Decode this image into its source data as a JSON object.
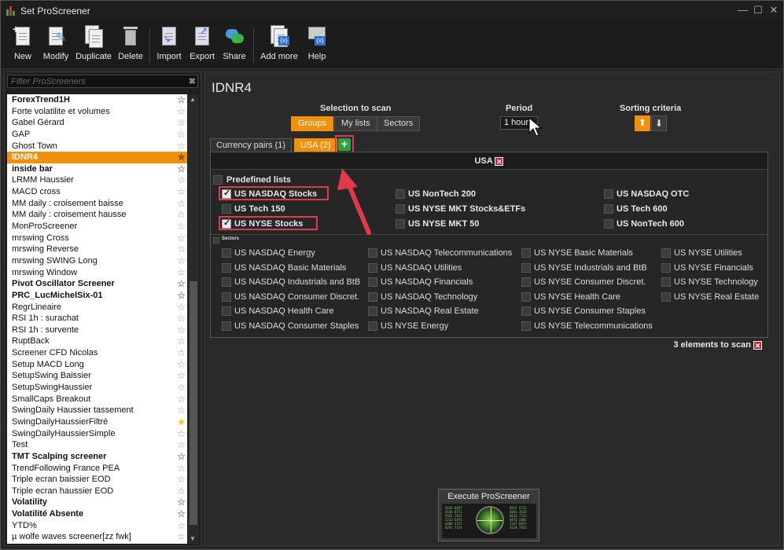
{
  "window": {
    "title": "Set ProScreener"
  },
  "toolbar": {
    "new": "New",
    "modify": "Modify",
    "duplicate": "Duplicate",
    "delete": "Delete",
    "import": "Import",
    "export": "Export",
    "share": "Share",
    "add_more": "Add more",
    "help": "Help"
  },
  "filter": {
    "placeholder": "Filter ProScreeners"
  },
  "screeners": [
    {
      "name": "ForexTrend1H",
      "bold": true,
      "star": "off"
    },
    {
      "name": "Forte volatilite et volumes",
      "bold": false,
      "star": "off"
    },
    {
      "name": "Gabel Gérard",
      "bold": false,
      "star": "off"
    },
    {
      "name": "GAP",
      "bold": false,
      "star": "off"
    },
    {
      "name": "Ghost Town",
      "bold": false,
      "star": "off"
    },
    {
      "name": "IDNR4",
      "bold": true,
      "star": "off",
      "selected": true
    },
    {
      "name": "inside bar",
      "bold": true,
      "star": "off"
    },
    {
      "name": "LRMM Haussier",
      "bold": false,
      "star": "off"
    },
    {
      "name": "MACD cross",
      "bold": false,
      "star": "off"
    },
    {
      "name": "MM daily : croisement baisse",
      "bold": false,
      "star": "off"
    },
    {
      "name": "MM daily : croisement hausse",
      "bold": false,
      "star": "off"
    },
    {
      "name": "MonProScreener",
      "bold": false,
      "star": "off"
    },
    {
      "name": "mrswing Cross",
      "bold": false,
      "star": "off"
    },
    {
      "name": "mrswing Reverse",
      "bold": false,
      "star": "off"
    },
    {
      "name": "mrswing SWING Long",
      "bold": false,
      "star": "off"
    },
    {
      "name": "mrswing Window",
      "bold": false,
      "star": "off"
    },
    {
      "name": "Pivot Oscillator Screener",
      "bold": true,
      "star": "off"
    },
    {
      "name": "PRC_LucMichelSix-01",
      "bold": true,
      "star": "off"
    },
    {
      "name": "RegrLineaire",
      "bold": false,
      "star": "off"
    },
    {
      "name": "RSI 1h : surachat",
      "bold": false,
      "star": "off"
    },
    {
      "name": "RSI 1h : survente",
      "bold": false,
      "star": "off"
    },
    {
      "name": "RuptBack",
      "bold": false,
      "star": "off"
    },
    {
      "name": "Screener CFD Nicolas",
      "bold": false,
      "star": "off"
    },
    {
      "name": "Setup MACD Long",
      "bold": false,
      "star": "off"
    },
    {
      "name": "SetupSwing Baissier",
      "bold": false,
      "star": "off"
    },
    {
      "name": "SetupSwingHaussier",
      "bold": false,
      "star": "off"
    },
    {
      "name": "SmallCaps Breakout",
      "bold": false,
      "star": "off"
    },
    {
      "name": "SwingDaily Haussier tassement",
      "bold": false,
      "star": "off"
    },
    {
      "name": "SwingDailyHaussierFiltré",
      "bold": false,
      "star": "on"
    },
    {
      "name": "SwingDailyHaussierSimple",
      "bold": false,
      "star": "off"
    },
    {
      "name": "Test",
      "bold": false,
      "star": "off"
    },
    {
      "name": "TMT Scalping screener",
      "bold": true,
      "star": "off"
    },
    {
      "name": "TrendFollowing France PEA",
      "bold": false,
      "star": "off"
    },
    {
      "name": "Triple ecran baissier EOD",
      "bold": false,
      "star": "off"
    },
    {
      "name": "Triple ecran haussier EOD",
      "bold": false,
      "star": "off"
    },
    {
      "name": "Volatility",
      "bold": true,
      "star": "off"
    },
    {
      "name": "Volatilité Absente",
      "bold": true,
      "star": "off"
    },
    {
      "name": "YTD%",
      "bold": false,
      "star": "off"
    },
    {
      "name": "µ wolfe waves screener[zz fwk]",
      "bold": false,
      "star": "off"
    }
  ],
  "screener_name": "IDNR4",
  "selection": {
    "header": "Selection to scan",
    "groups": "Groups",
    "my_lists": "My lists",
    "sectors": "Sectors"
  },
  "period": {
    "header": "Period",
    "value": "1 hour"
  },
  "sorting": {
    "header": "Sorting criteria"
  },
  "tabs": {
    "currency": "Currency pairs (1)",
    "usa": "USA (2)"
  },
  "panel": {
    "title": "USA",
    "predefined_header": "Predefined lists",
    "predefined": [
      {
        "label": "US NASDAQ Stocks",
        "checked": true
      },
      {
        "label": "US Tech 150",
        "checked": false
      },
      {
        "label": "US NYSE Stocks",
        "checked": true
      },
      {
        "label": "US NonTech 200",
        "checked": false
      },
      {
        "label": "US NYSE MKT Stocks&ETFs",
        "checked": false
      },
      {
        "label": "US NYSE MKT 50",
        "checked": false
      },
      {
        "label": "US NASDAQ OTC",
        "checked": false
      },
      {
        "label": "US Tech 600",
        "checked": false
      },
      {
        "label": "US NonTech 600",
        "checked": false
      }
    ],
    "sectors_header": "Sectors",
    "sectors": [
      "US NASDAQ Energy",
      "US NASDAQ Basic Materials",
      "US NASDAQ Industrials and BtB",
      "US NASDAQ Consumer Discret.",
      "US NASDAQ Health Care",
      "US NASDAQ Consumer Staples",
      "US NASDAQ Telecommunications",
      "US NASDAQ Utilities",
      "US NASDAQ Financials",
      "US NASDAQ Technology",
      "US NASDAQ Real Estate",
      "US NYSE Energy",
      "US NYSE Basic Materials",
      "US NYSE Industrials and BtB",
      "US NYSE Consumer Discret.",
      "US NYSE Health Care",
      "US NYSE Consumer Staples",
      "US NYSE Telecommunications",
      "US NYSE Utilities",
      "US NYSE Financials",
      "US NYSE Technology",
      "US NYSE Real Estate"
    ]
  },
  "count_text": "3 elements to scan",
  "execute_label": "Execute ProScreener",
  "colors": {
    "accent": "#f0900d",
    "highlight": "#e03a4a",
    "add": "#2ea340"
  }
}
